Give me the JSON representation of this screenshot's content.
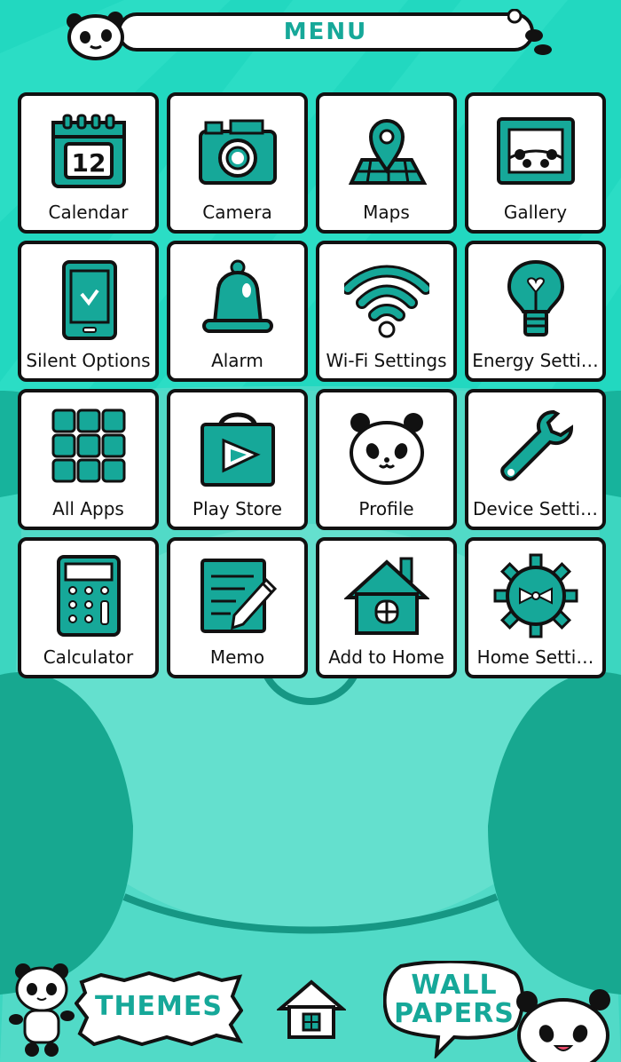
{
  "header": {
    "title": "MENU"
  },
  "tiles": [
    {
      "label": "Calendar",
      "icon": "calendar-icon",
      "date": "12"
    },
    {
      "label": "Camera",
      "icon": "camera-icon"
    },
    {
      "label": "Maps",
      "icon": "map-pin-icon"
    },
    {
      "label": "Gallery",
      "icon": "gallery-icon"
    },
    {
      "label": "Silent Options",
      "icon": "phone-silent-icon"
    },
    {
      "label": "Alarm",
      "icon": "bell-icon"
    },
    {
      "label": "Wi-Fi Settings",
      "icon": "wifi-icon"
    },
    {
      "label": "Energy Setti…",
      "icon": "lightbulb-icon"
    },
    {
      "label": "All Apps",
      "icon": "grid-icon"
    },
    {
      "label": "Play Store",
      "icon": "shopping-bag-play-icon"
    },
    {
      "label": "Profile",
      "icon": "panda-face-icon"
    },
    {
      "label": "Device Setti…",
      "icon": "wrench-icon"
    },
    {
      "label": "Calculator",
      "icon": "calculator-icon"
    },
    {
      "label": "Memo",
      "icon": "memo-pencil-icon"
    },
    {
      "label": "Add to Home",
      "icon": "house-icon"
    },
    {
      "label": "Home Setti…",
      "icon": "gear-bowtie-icon"
    }
  ],
  "bottom": {
    "themes_label": "THEMES",
    "wallpapers_line1": "WALL",
    "wallpapers_line2": "PAPERS"
  },
  "colors": {
    "teal": "#16a899",
    "bg": "#22d8c0",
    "dark": "#111111"
  }
}
